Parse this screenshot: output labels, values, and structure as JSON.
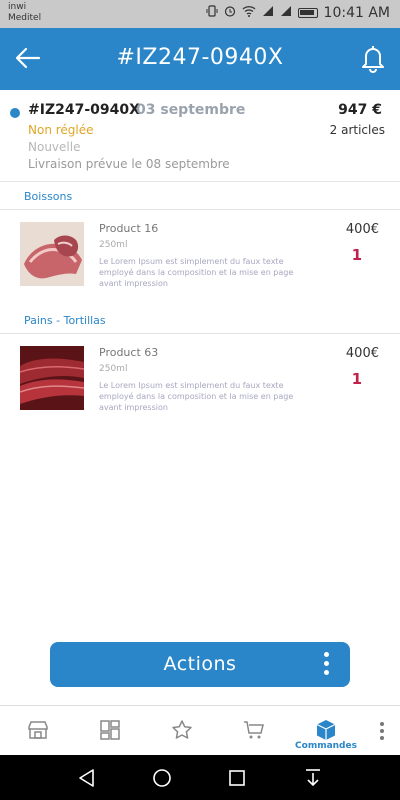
{
  "status_bar": {
    "carrier_line1": "inwi",
    "carrier_line2": "Meditel",
    "time": "10:41 AM"
  },
  "appbar": {
    "title": "#IZ247-0940X",
    "back_icon": "arrow-left-icon",
    "notification_icon": "bell-icon"
  },
  "order": {
    "id": "#IZ247-0940X",
    "date": "03 septembre",
    "total": "947 €",
    "articles": "2 articles",
    "payment_status": "Non réglée",
    "state": "Nouvelle",
    "delivery": "Livraison prévue le 08 septembre"
  },
  "sections": [
    {
      "category": "Boissons",
      "products": [
        {
          "name": "Product 16",
          "volume": "250ml",
          "description": "Le Lorem Ipsum est simplement du faux texte employé dans la composition et la mise en page avant impression",
          "price": "400€",
          "quantity": "1"
        }
      ]
    },
    {
      "category": "Pains - Tortillas",
      "products": [
        {
          "name": "Product 63",
          "volume": "250ml",
          "description": "Le Lorem Ipsum est simplement du faux texte employé dans la composition et la mise en page avant impression",
          "price": "400€",
          "quantity": "1"
        }
      ]
    }
  ],
  "actions": {
    "label": "Actions"
  },
  "bottom_nav": {
    "items": [
      {
        "icon": "shop-icon",
        "label": ""
      },
      {
        "icon": "dashboard-icon",
        "label": ""
      },
      {
        "icon": "star-icon",
        "label": ""
      },
      {
        "icon": "cart-icon",
        "label": ""
      },
      {
        "icon": "box-icon",
        "label": "Commandes",
        "active": true
      }
    ]
  },
  "colors": {
    "primary": "#2a86c8",
    "warning": "#e0a526",
    "quantity": "#c0224c"
  }
}
